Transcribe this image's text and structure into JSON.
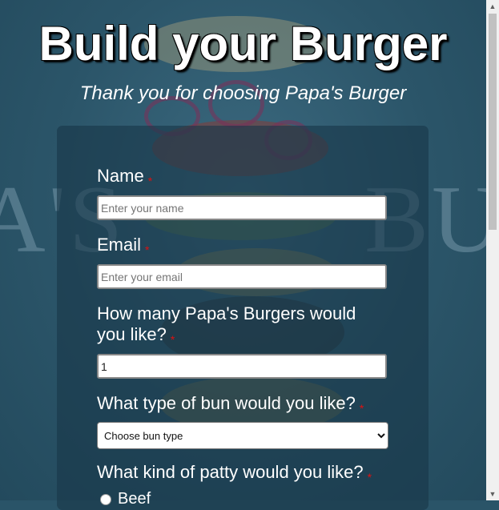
{
  "header": {
    "title": "Build your Burger",
    "subtitle": "Thank you for choosing Papa's Burger"
  },
  "background": {
    "word_left": "A'S",
    "word_right": "BUR"
  },
  "form": {
    "required_mark": "*",
    "name": {
      "label": "Name",
      "placeholder": "Enter your name",
      "value": ""
    },
    "email": {
      "label": "Email",
      "placeholder": "Enter your email",
      "value": ""
    },
    "quantity": {
      "label_line1": "How many Papa's Burgers would",
      "label_line2": "you like?",
      "value": "1"
    },
    "bun": {
      "label": "What type of bun would you like?",
      "selected": "Choose bun type",
      "options": [
        "Choose bun type"
      ]
    },
    "patty": {
      "label": "What kind of patty would you like?",
      "options": [
        "Beef"
      ]
    }
  },
  "colors": {
    "required": "#dd1111",
    "card": "rgba(25,55,72,0.62)"
  },
  "scrollbar": {
    "up_icon": "▲",
    "down_icon": "▼"
  }
}
